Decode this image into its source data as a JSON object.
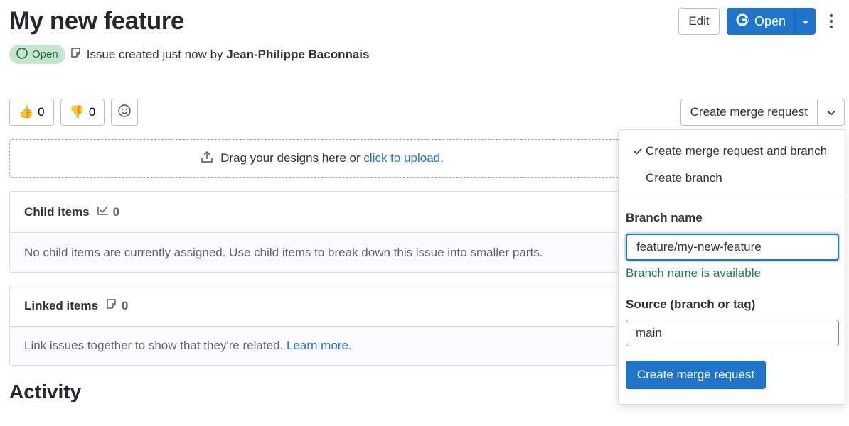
{
  "issue": {
    "title": "My new feature",
    "status": "Open",
    "created_text": "Issue created just now by",
    "author": "Jean-Philippe Baconnais"
  },
  "header": {
    "edit_label": "Edit",
    "open_label": "Open"
  },
  "reactions": {
    "thumbs_up_count": "0",
    "thumbs_down_count": "0",
    "thumbs_up_emoji": "👍",
    "thumbs_down_emoji": "👎"
  },
  "merge_request": {
    "button_label": "Create merge request"
  },
  "upload": {
    "text": "Drag your designs here or",
    "link": "click to upload",
    "suffix": "."
  },
  "child_items": {
    "title": "Child items",
    "count": "0",
    "empty_text": "No child items are currently assigned. Use child items to break down this issue into smaller parts."
  },
  "linked_items": {
    "title": "Linked items",
    "count": "0",
    "text": "Link issues together to show that they're related.",
    "link": "Learn more."
  },
  "activity": {
    "title": "Activity"
  },
  "dropdown": {
    "options": [
      "Create merge request and branch",
      "Create branch"
    ],
    "selected_index": 0,
    "branch_label": "Branch name",
    "branch_value": "feature/my-new-feature",
    "availability": "Branch name is available",
    "source_label": "Source (branch or tag)",
    "source_value": "main",
    "submit_label": "Create merge request"
  },
  "colors": {
    "primary": "#1f75cb",
    "success": "#108548",
    "status_badge_bg": "#c3e6cd",
    "status_badge_text": "#24663b"
  }
}
